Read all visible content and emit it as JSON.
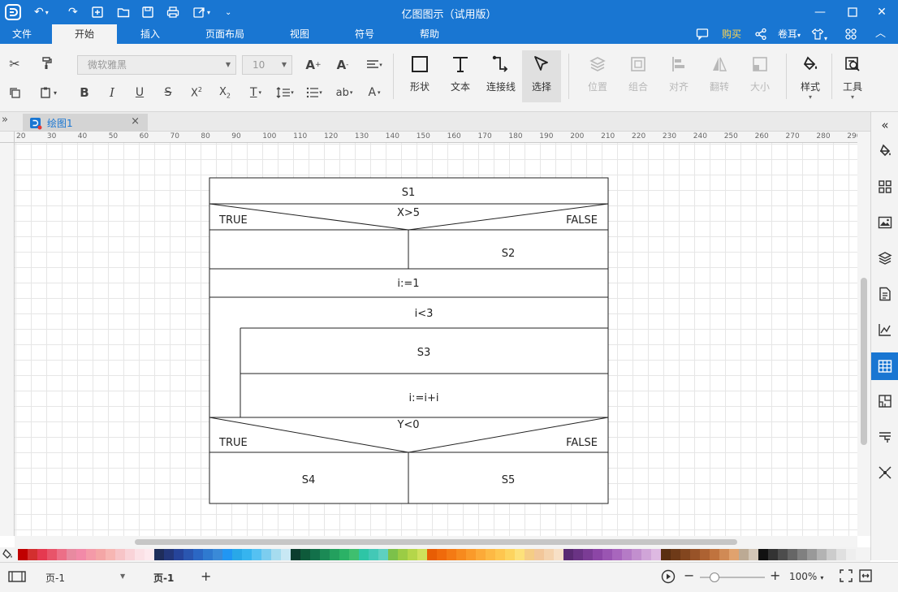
{
  "window": {
    "title": "亿图图示（试用版）",
    "accent": "#1976d2"
  },
  "menu": {
    "tabs": [
      "文件",
      "开始",
      "插入",
      "页面布局",
      "视图",
      "符号",
      "帮助"
    ],
    "active_tab": "开始",
    "buy_label": "购买",
    "buy_color": "#ffd54f",
    "user_label": "卷耳"
  },
  "ribbon": {
    "font_name": "微软雅黑",
    "font_size": "10",
    "big_buttons": {
      "shape": "形状",
      "text": "文本",
      "connector": "连接线",
      "select": "选择",
      "position": "位置",
      "group": "组合",
      "align": "对齐",
      "flip": "翻转",
      "size": "大小",
      "style": "样式",
      "tools": "工具"
    }
  },
  "document": {
    "tab_label": "绘图1",
    "close_glyph": "×"
  },
  "ruler": {
    "labels": [
      "20",
      "30",
      "40",
      "50",
      "60",
      "70",
      "80",
      "90",
      "100",
      "110",
      "120",
      "130",
      "140",
      "150",
      "160",
      "170",
      "180",
      "190",
      "200",
      "210",
      "220",
      "230",
      "240",
      "250",
      "260",
      "270",
      "280",
      "290"
    ]
  },
  "diagram": {
    "s1": "S1",
    "cond1": "X>5",
    "true1": "TRUE",
    "false1": "FALSE",
    "s2": "S2",
    "init": "i:=1",
    "loop": "i<3",
    "s3": "S3",
    "incr": "i:=i+i",
    "cond2": "Y<0",
    "true2": "TRUE",
    "false2": "FALSE",
    "s4": "S4",
    "s5": "S5"
  },
  "palette": {
    "colors": [
      "#c00000",
      "#d32f2f",
      "#e53950",
      "#e8546a",
      "#ec6f87",
      "#e88aa0",
      "#f28aa8",
      "#f49aa8",
      "#f4a6a6",
      "#f7b6b3",
      "#f7c4c7",
      "#f9d3d8",
      "#fbe1e6",
      "#fde9ee",
      "#1f2d5a",
      "#23377a",
      "#26449a",
      "#2a56b0",
      "#2b67c4",
      "#2f7ad0",
      "#3a8ad8",
      "#2196f3",
      "#29a8e8",
      "#36b4ef",
      "#55c1f2",
      "#7ccdef",
      "#a6dcef",
      "#c8e8f4",
      "#0b3d2e",
      "#0e5a3a",
      "#12704a",
      "#1b8a55",
      "#23a05e",
      "#2bb266",
      "#3fbf6f",
      "#2ec5a6",
      "#43c8b6",
      "#5ed0c0",
      "#7cc14a",
      "#9bcc45",
      "#b5d64a",
      "#cfe05b",
      "#e85d04",
      "#f06a0b",
      "#f47a14",
      "#f78a1e",
      "#fa9a2a",
      "#fcaa38",
      "#fdb944",
      "#fec64f",
      "#fdd45f",
      "#fde17a",
      "#f5cd85",
      "#f2c79a",
      "#f4d3ae",
      "#f7e0c6",
      "#5a2a72",
      "#6a3384",
      "#7b3c95",
      "#8c46a6",
      "#9a55b2",
      "#a866bd",
      "#b57bc6",
      "#c28fce",
      "#d0a5d8",
      "#deb9e2",
      "#5a2e12",
      "#6e3a18",
      "#83461f",
      "#985328",
      "#ad6232",
      "#c0733e",
      "#d08a55",
      "#e0a26e",
      "#bcaa94",
      "#d3c6b6",
      "#111111",
      "#333333",
      "#4d4d4d",
      "#666666",
      "#808080",
      "#999999",
      "#b3b3b3",
      "#cccccc",
      "#e0e0e0",
      "#eeeeee"
    ]
  },
  "status": {
    "page_selector": "页-1",
    "page_tab": "页-1",
    "add_glyph": "+",
    "zoom": "100%"
  }
}
